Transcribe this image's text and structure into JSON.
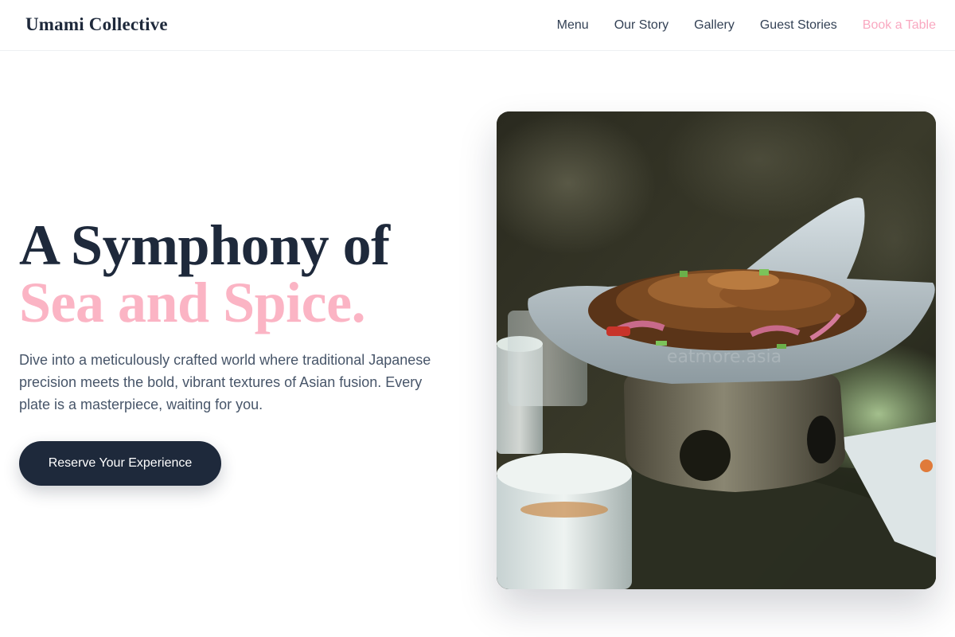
{
  "header": {
    "brand": "Umami Collective",
    "nav": [
      {
        "label": "Menu"
      },
      {
        "label": "Our Story"
      },
      {
        "label": "Gallery"
      },
      {
        "label": "Guest Stories"
      }
    ],
    "cta_label": "Book a Table"
  },
  "hero": {
    "title_line1": "A Symphony of",
    "title_line2": "Sea and Spice.",
    "description": "Dive into a meticulously crafted world where traditional Japanese precision meets the bold, vibrant textures of Asian fusion. Every plate is a masterpiece, waiting for you.",
    "button_label": "Reserve Your Experience",
    "image_watermark": "eatmore.asia"
  },
  "colors": {
    "primary_dark": "#1e293b",
    "accent_pink": "#fbb4c4",
    "body_text": "#475569"
  }
}
